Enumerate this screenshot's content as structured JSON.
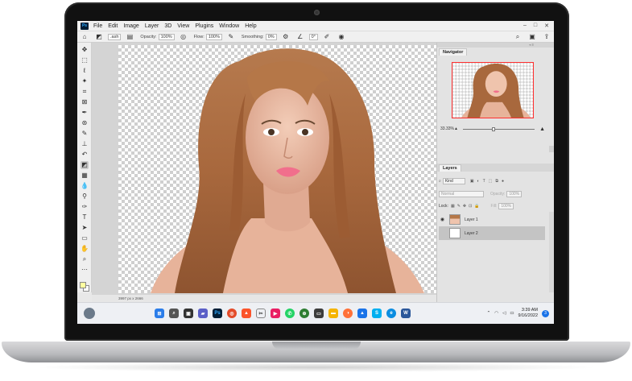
{
  "app": {
    "logo": "Ps",
    "menu": [
      "File",
      "Edit",
      "Image",
      "Layer",
      "3D",
      "View",
      "Plugins",
      "Window",
      "Help"
    ],
    "window_controls": [
      "–",
      "□",
      "✕"
    ]
  },
  "options_bar": {
    "brush_size": ".ash",
    "opacity_label": "Opacity:",
    "opacity_value": "100%",
    "flow_label": "Flow:",
    "flow_value": "100%",
    "smoothing_label": "Smoothing:",
    "smoothing_value": "0%",
    "angle_value": "0°"
  },
  "canvas": {
    "status": "3997 px x 2666"
  },
  "navigator": {
    "tab": "Navigator",
    "zoom": "33.33%"
  },
  "layers": {
    "tab": "Layers",
    "kind_label": "Kind",
    "blend_mode": "Normal",
    "opacity_label": "Opacity:",
    "opacity_value": "100%",
    "lock_label": "Lock:",
    "fill_label": "Fill:",
    "fill_value": "100%",
    "items": [
      {
        "name": "Layer 1",
        "visible": true,
        "selected": false
      },
      {
        "name": "Layer 2",
        "visible": false,
        "selected": true
      }
    ]
  },
  "taskbar": {
    "time": "3:39 AM",
    "date": "9/16/2022",
    "notifications": "3"
  },
  "colors": {
    "foreground": "#ffff9f",
    "background": "#ffffff",
    "accent": "#31a8ff"
  }
}
